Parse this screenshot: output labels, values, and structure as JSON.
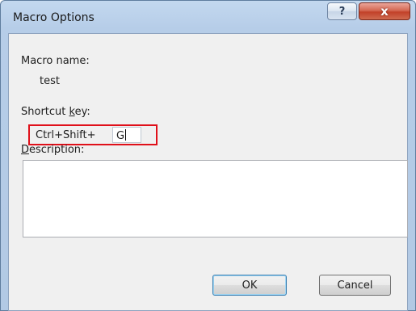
{
  "window": {
    "title": "Macro Options",
    "help_label": "?",
    "close_label": "x"
  },
  "macro_name": {
    "label": "Macro name:",
    "value": "test"
  },
  "shortcut": {
    "label_before": "Shortcut ",
    "label_key": "k",
    "label_after": "ey:",
    "prefix": "Ctrl+Shift+",
    "key_value": "G"
  },
  "description": {
    "label_key": "D",
    "label_rest": "escription:",
    "value": ""
  },
  "buttons": {
    "ok": "OK",
    "cancel": "Cancel"
  },
  "colors": {
    "highlight_border": "#e0101a",
    "titlebar": "#b6cde8",
    "close_button": "#c24129"
  }
}
